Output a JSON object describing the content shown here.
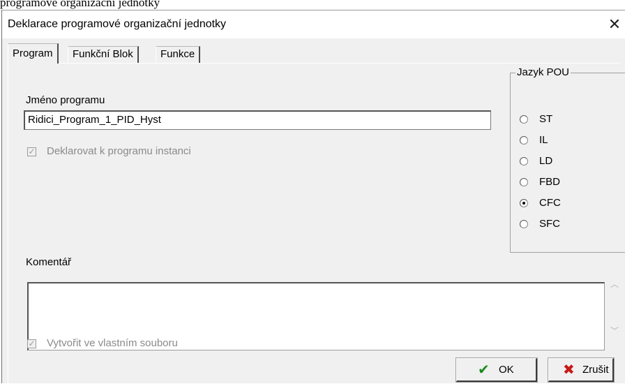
{
  "above_text": "programové organizační jednotky",
  "window": {
    "title": "Deklarace programové organizační jednotky",
    "close_glyph": "✕"
  },
  "tabs": [
    {
      "label": "Program",
      "active": true
    },
    {
      "label": "Funkční Blok",
      "active": false
    },
    {
      "label": "Funkce",
      "active": false
    }
  ],
  "program": {
    "name_label": "Jméno programu",
    "name_value": "Ridici_Program_1_PID_Hyst",
    "declare_instance_label": "Deklarovat k programu instanci",
    "declare_instance_checked": true
  },
  "language": {
    "group_title": "Jazyk POU",
    "options": [
      {
        "label": "ST",
        "checked": false
      },
      {
        "label": "IL",
        "checked": false
      },
      {
        "label": "LD",
        "checked": false
      },
      {
        "label": "FBD",
        "checked": false
      },
      {
        "label": "CFC",
        "checked": true
      },
      {
        "label": "SFC",
        "checked": false
      }
    ]
  },
  "comment": {
    "label": "Komentář",
    "value": "",
    "scroll_up": "︿",
    "scroll_down": "﹀"
  },
  "own_file": {
    "label": "Vytvořit ve vlastním souboru",
    "checked": true
  },
  "buttons": {
    "ok_label": "OK",
    "ok_icon": "✔",
    "cancel_label": "Zrušit",
    "cancel_icon": "✖"
  },
  "colors": {
    "ok_icon": "#1a8a1a",
    "cancel_icon": "#c81818",
    "disabled_text": "#8a8a8a"
  }
}
